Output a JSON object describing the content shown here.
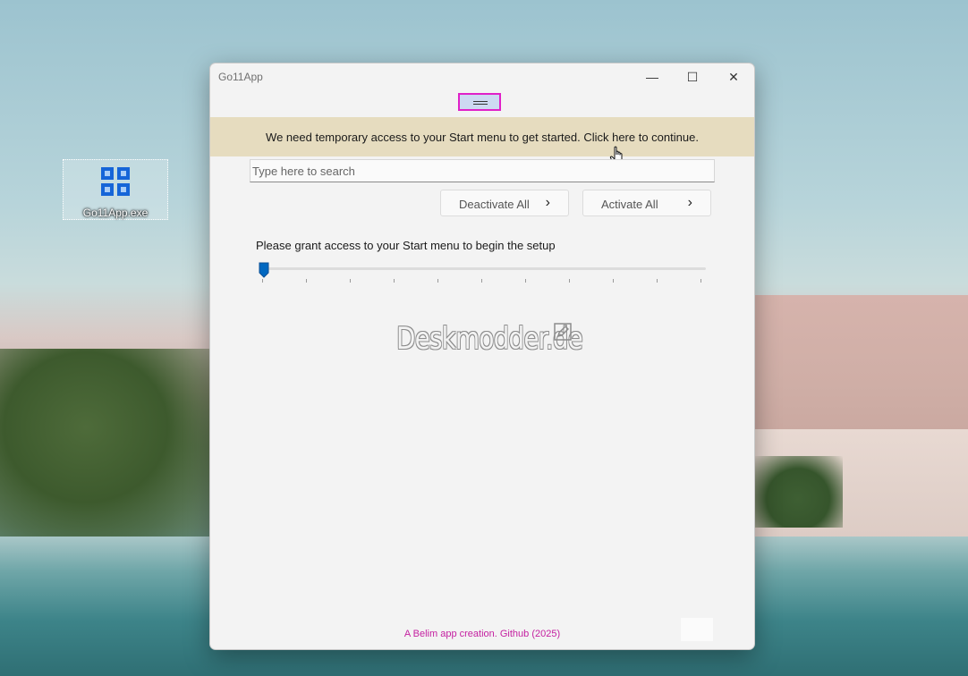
{
  "desktop": {
    "icon_label": "Go11App.exe"
  },
  "window": {
    "title": "Go11App",
    "controls": {
      "minimize": "—",
      "maximize": "☐",
      "close": "✕"
    }
  },
  "banner": {
    "message": "We need temporary access to your Start menu to get started. Click here to continue."
  },
  "search": {
    "placeholder": "Type here to search",
    "value": ""
  },
  "buttons": {
    "deactivate_all": "Deactivate All",
    "activate_all": "Activate All",
    "chevron": "›"
  },
  "setup": {
    "message": "Please grant access to your Start menu to begin the setup",
    "progress_fraction": 0.0,
    "tick_count": 11
  },
  "watermark": {
    "text": "Deskmodder.de"
  },
  "footer": {
    "text": "A Belim app creation. Github (2025)"
  },
  "colors": {
    "banner_bg": "#e6dcbf",
    "accent": "#0067c0",
    "footer_text": "#c41fa0",
    "highlight_border": "#e020c8"
  }
}
